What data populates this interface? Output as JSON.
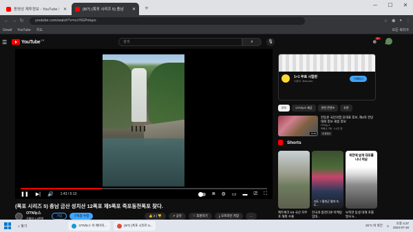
{
  "browser": {
    "tabs": [
      {
        "label": "동영상 제투정보 - YouTube Stu",
        "active": false
      },
      {
        "label": "(8/7) (폭포 시리즈 5) 충남",
        "active": true
      }
    ],
    "new_tab": "+",
    "window_controls": [
      "─",
      "☐",
      "✕"
    ],
    "nav": {
      "back": "←",
      "forward": "→",
      "reload": "↻"
    },
    "url": "youtube.com/watch?v=cuYtGPnlayo",
    "bookmarks": [
      "Gmail",
      "YouTube",
      "지도"
    ],
    "bookmarks_right": "모든 북마크"
  },
  "youtube": {
    "logo_text": "YouTube",
    "logo_region": "KR",
    "search_placeholder": "검색",
    "notification_count": "9+"
  },
  "player": {
    "time": "1:43 / 5:13",
    "progress_fraction": 0.33
  },
  "video": {
    "title": "(폭포 시리즈 5) 충남 금산 성치산 12폭포 제5폭포 죽포동천폭포 찾다.",
    "channel": "OTN뉴스",
    "subscribers": "구독자 1.5천명",
    "join_label": "가입",
    "subscribe_label": "구독중 수정",
    "like_count": "2",
    "share_label": "공유",
    "support_label": "후원하기",
    "offline_label": "오프라인 저장",
    "more_label": "..."
  },
  "sidebar": {
    "ad": {
      "title": "1+1 무료 시험판",
      "source": "스폰서 · linss.com",
      "button": "구매하기"
    },
    "chips": [
      "모두",
      "OTN뉴스 제공",
      "관련 콘텐츠",
      "추천"
    ],
    "rec": {
      "title": "한동훈 국민의힘 당대표 후보, 제4차 전당대회 후보 세종 후보",
      "channel": "OTN뉴스",
      "meta": "조회수 7회 · 1시간 전",
      "badge": "새 동영상",
      "duration": "10:48"
    },
    "shorts_title": "Shorts",
    "shorts": [
      {
        "caption": "팩트체크 K9 국산 자주포 해외 수출",
        "overlay": ""
      },
      {
        "caption": "한국과 합천다큐 마케팅 임대...",
        "overlay": "지도 7 홍천군 평야 속도..."
      },
      {
        "caption": "보쪽한 동생 대해 포를 발사 9...",
        "overlay": "북한에 날개 대포를 나나 떠남"
      }
    ]
  },
  "taskbar": {
    "search": "찾기",
    "apps": [
      "OTN뉴스 이 페이지...",
      "(8/7) (폭포 시리즈 5..."
    ],
    "weather": "25°C 비 약간",
    "lang": "A",
    "time": "오후 4:37",
    "date": "2024-07-16"
  }
}
